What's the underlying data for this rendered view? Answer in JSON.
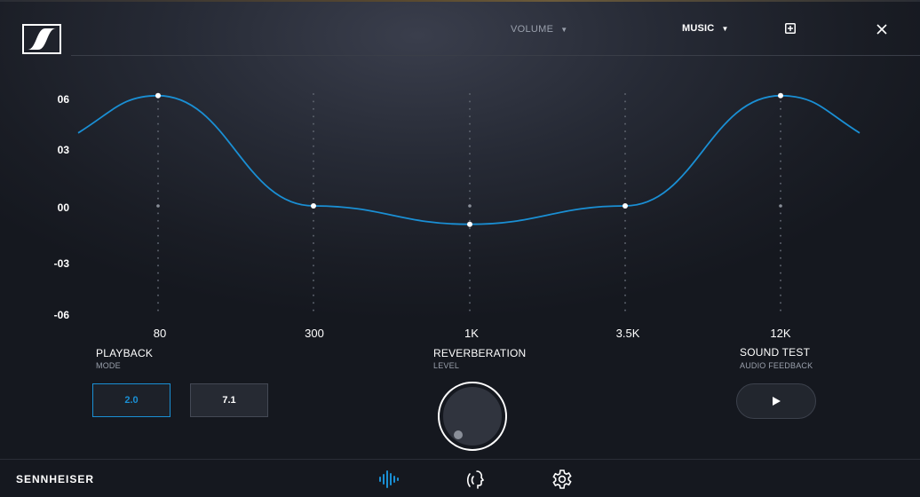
{
  "header": {
    "volume_label": "VOLUME",
    "profile_label": "MUSIC",
    "caret": "▼"
  },
  "eq": {
    "y_ticks": [
      "06",
      "03",
      "00",
      "-03",
      "-06"
    ],
    "bands": [
      "80",
      "300",
      "1K",
      "3.5K",
      "12K"
    ],
    "gains_db": [
      6,
      0,
      -1,
      0,
      6
    ],
    "curve_color": "#1a8fd4"
  },
  "playback": {
    "title": "PLAYBACK",
    "subtitle": "MODE",
    "options": [
      "2.0",
      "7.1"
    ],
    "selected": "2.0"
  },
  "reverberation": {
    "title": "REVERBERATION",
    "subtitle": "LEVEL"
  },
  "sound_test": {
    "title": "SOUND TEST",
    "subtitle": "AUDIO FEEDBACK"
  },
  "footer": {
    "brand": "SENNHEISER",
    "icons": [
      "equalizer-icon",
      "voice-icon",
      "settings-icon"
    ],
    "active_color": "#1a8fd4"
  }
}
